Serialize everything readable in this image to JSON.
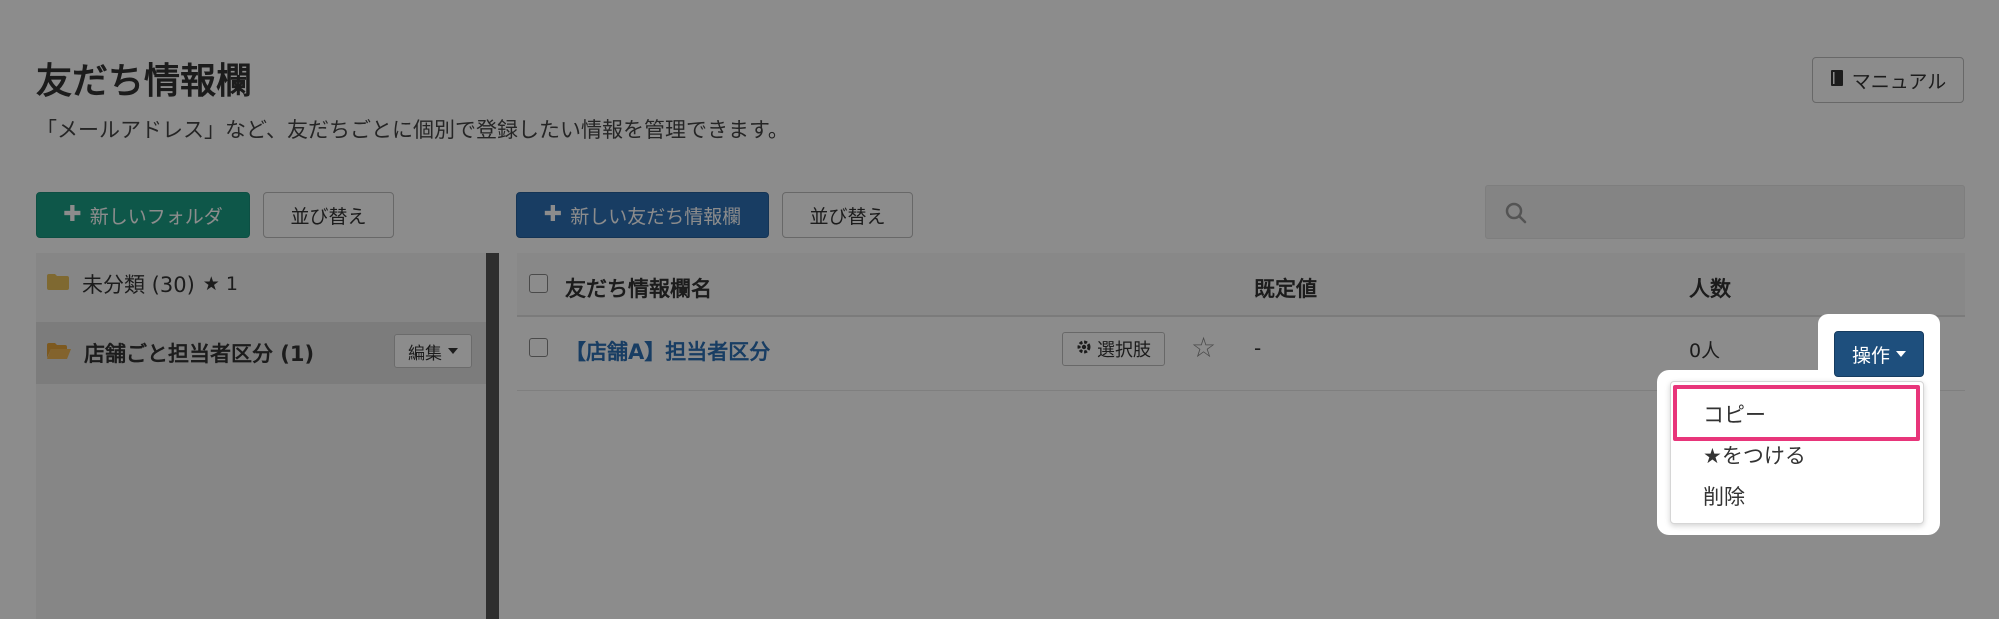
{
  "page": {
    "title": "友だち情報欄",
    "subtitle": "「メールアドレス」など、友だちごとに個別で登録したい情報を管理できます。",
    "manual_label": "マニュアル"
  },
  "toolbar_left": {
    "new_folder_label": "新しいフォルダ",
    "sort_label": "並び替え"
  },
  "toolbar_right": {
    "new_field_label": "新しい友だち情報欄",
    "sort_label": "並び替え",
    "search_placeholder": ""
  },
  "folders": [
    {
      "label": "未分類 (30)",
      "star_label": "★ 1",
      "selected": false
    },
    {
      "label": "店舗ごと担当者区分 (1)",
      "edit_label": "編集",
      "selected": true
    }
  ],
  "table": {
    "headers": {
      "name": "友だち情報欄名",
      "default": "既定値",
      "count": "人数"
    },
    "rows": [
      {
        "name": "【店舗A】担当者区分",
        "choices_label": "選択肢",
        "default": "-",
        "count": "0人",
        "action_label": "操作"
      }
    ]
  },
  "dropdown": {
    "items": [
      "コピー",
      "★をつける",
      "削除"
    ]
  },
  "colors": {
    "teal": "#1b9f86",
    "blue": "#2d70b5",
    "dark_blue": "#1e4f7d",
    "highlight": "#e8357a"
  }
}
